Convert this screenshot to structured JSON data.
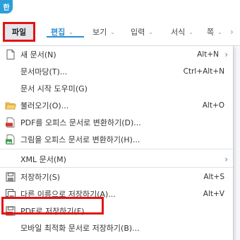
{
  "app": {
    "badge": "한"
  },
  "menubar": {
    "items": [
      {
        "label": "파일"
      },
      {
        "label": "편집"
      },
      {
        "label": "보기"
      },
      {
        "label": "입력"
      },
      {
        "label": "서식"
      },
      {
        "label": "쪽"
      }
    ]
  },
  "file_menu": {
    "items": [
      {
        "label": "새 문서(N)",
        "shortcut": "Alt+N",
        "icon": "new-doc-icon",
        "submenu": true
      },
      {
        "label": "문서마당(T)...",
        "shortcut": "Ctrl+Alt+N"
      },
      {
        "label": "문서 시작 도우미(G)"
      },
      {
        "label": "불러오기(O)...",
        "shortcut": "Alt+O",
        "icon": "folder-open-icon"
      },
      {
        "label": "PDF를 오피스 문서로 변환하기(D)...",
        "icon": "pdf-icon"
      },
      {
        "label": "그림을 오피스 문서로 변환하기(H)...",
        "icon": "image-icon"
      },
      {
        "label": "XML 문서(M)",
        "submenu": true
      },
      {
        "label": "저장하기(S)",
        "shortcut": "Alt+S",
        "icon": "save-icon"
      },
      {
        "label": "다른 이름으로 저장하기(A)...",
        "shortcut": "Alt+V",
        "icon": "save-as-icon"
      },
      {
        "label": "PDF로 저장하기(F)...",
        "icon": "pdf-save-icon"
      },
      {
        "label": "모바일 최적화 문서로 저장하기(B)..."
      }
    ]
  },
  "colors": {
    "accent": "#2c8fd2",
    "highlight_box": "#e31414",
    "app_badge": "#2b9fd9"
  }
}
